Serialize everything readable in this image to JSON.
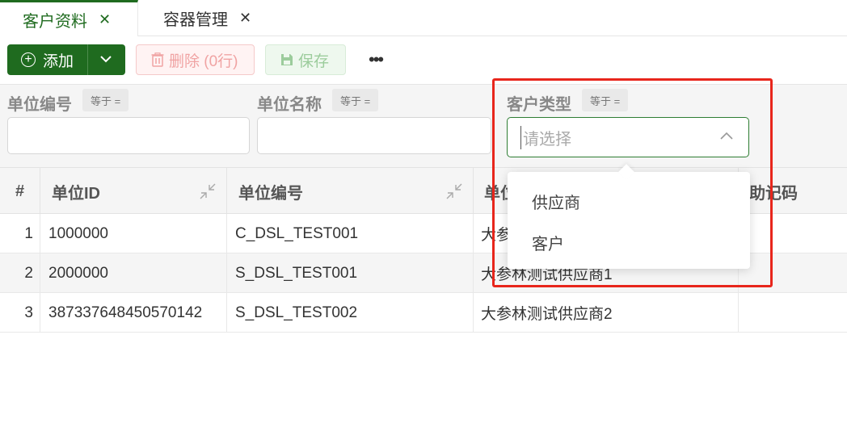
{
  "tabs": [
    {
      "label": "客户资料",
      "active": true
    },
    {
      "label": "容器管理",
      "active": false
    }
  ],
  "toolbar": {
    "add_label": "添加",
    "delete_label": "删除 (0行)",
    "save_label": "保存",
    "more_label": "•••"
  },
  "filters": [
    {
      "label": "单位编号",
      "operator": "等于 ="
    },
    {
      "label": "单位名称",
      "operator": "等于 ="
    },
    {
      "label": "客户类型",
      "operator": "等于 =",
      "placeholder": "请选择"
    }
  ],
  "table": {
    "headers": [
      "#",
      "单位ID",
      "单位编号",
      "单位",
      "助记码"
    ],
    "rows": [
      {
        "index": "1",
        "id": "1000000",
        "code": "C_DSL_TEST001",
        "name": "大参"
      },
      {
        "index": "2",
        "id": "2000000",
        "code": "S_DSL_TEST001",
        "name": "大参林测试供应商1"
      },
      {
        "index": "3",
        "id": "387337648450570142",
        "code": "S_DSL_TEST002",
        "name": "大参林测试供应商2"
      }
    ]
  },
  "dropdown": {
    "options": [
      "供应商",
      "客户"
    ]
  },
  "colors": {
    "primary": "#1f6b1f",
    "annotation": "#e8261c",
    "danger_light": "#f0a3a3"
  }
}
